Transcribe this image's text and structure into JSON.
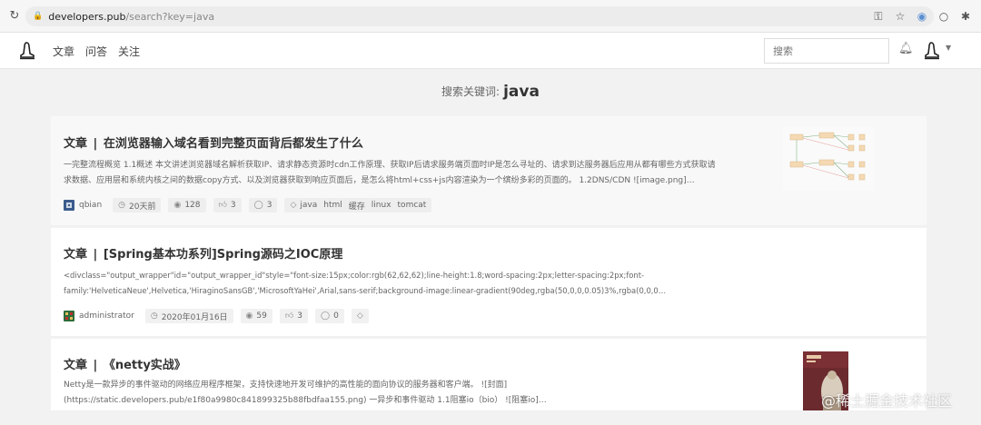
{
  "browser": {
    "url_host": "developers.pub",
    "url_path": "/search?key=java"
  },
  "site": {
    "nav": [
      "文章",
      "问答",
      "关注"
    ],
    "search_placeholder": "搜索"
  },
  "search": {
    "label": "搜索关键词:",
    "keyword": "java"
  },
  "results": [
    {
      "type": "文章",
      "title": "在浏览器输入域名看到完整页面背后都发生了什么",
      "excerpt_lines": [
        "一完整流程概览 1.1概述 本文讲述浏览器域名解析获取IP、请求静态资源时cdn工作原理、获取IP后请求服务端页面时IP是怎么寻址的、请求到达服务器后应用从都有哪些方式获取请",
        "求数据、应用层和系统内核之间的数据copy方式、以及浏览器获取到响应页面后，是怎么将html+css+js内容渲染为一个缤纷多彩的页面的。 1.2DNS/CDN ![image.png]…"
      ],
      "author": "qbian",
      "time": "20天前",
      "views": "128",
      "likes": "3",
      "comments": "3",
      "tags": [
        "java",
        "html",
        "缓存",
        "linux",
        "tomcat"
      ]
    },
    {
      "type": "文章",
      "title": "[Spring基本功系列]Spring源码之IOC原理",
      "excerpt_lines": [
        "<divclass=\"output_wrapper\"id=\"output_wrapper_id\"style=\"font-size:15px;color:rgb(62,62,62);line-height:1.8;word-spacing:2px;letter-spacing:2px;font-",
        "family:'HelveticaNeue',Helvetica,'HiraginoSansGB','MicrosoftYaHei',Arial,sans-serif;background-image:linear-gradient(90deg,rgba(50,0,0,0.05)3%,rgba(0,0,0…"
      ],
      "author": "administrator",
      "time": "2020年01月16日",
      "views": "59",
      "likes": "3",
      "comments": "0",
      "tags": []
    },
    {
      "type": "文章",
      "title": "《netty实战》",
      "excerpt_lines": [
        "Netty是一款异步的事件驱动的网络应用程序框架，支持快速地开发可维护的高性能的面向协议的服务器和客户端。 ![封面]",
        "(https://static.developers.pub/e1f80a9980c841899325b88fbdfaa155.png) 一异步和事件驱动 1.1阻塞io（bio） ![阻塞io]…"
      ]
    }
  ],
  "watermark": "@稀土掘金技术社区",
  "colors": {
    "page_bg": "#f2f2f2",
    "card_bg": "#ffffff",
    "chip_bg": "#f1f1f1",
    "title": "#333333"
  }
}
